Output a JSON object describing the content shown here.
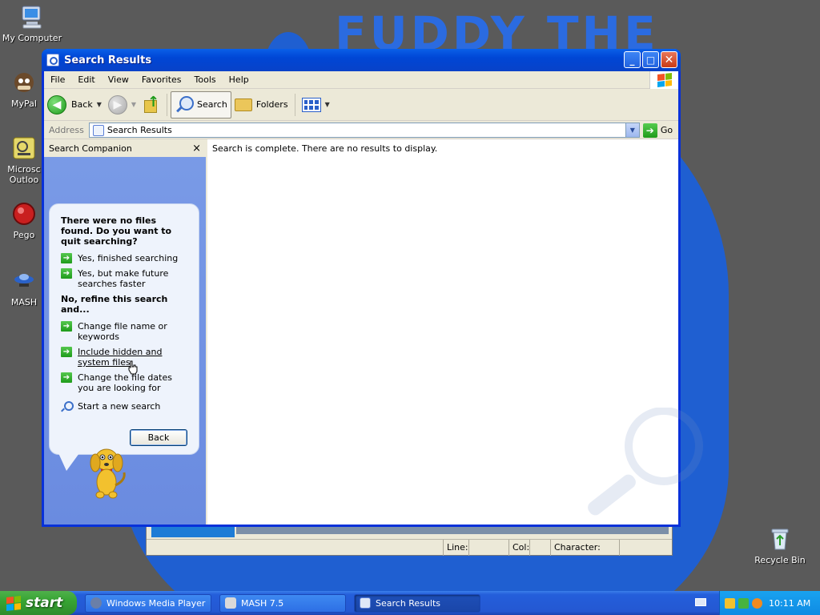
{
  "desktop": {
    "wallpaper_text": "FUDDY THE",
    "icons": [
      {
        "label": "My Computer",
        "icon": "computer-icon"
      },
      {
        "label": "MyPal",
        "icon": "mypal-icon"
      },
      {
        "label": "Microsc Outloo",
        "icon": "outlook-icon"
      },
      {
        "label": "Pego",
        "icon": "pego-icon"
      },
      {
        "label": "MASH",
        "icon": "mash-icon"
      },
      {
        "label": "Recycle Bin",
        "icon": "recycle-bin-icon"
      }
    ]
  },
  "background_window": {
    "status": {
      "line": "Line:",
      "col": "Col:",
      "character": "Character:"
    }
  },
  "window": {
    "title": "Search Results",
    "menu": [
      "File",
      "Edit",
      "View",
      "Favorites",
      "Tools",
      "Help"
    ],
    "toolbar": {
      "back": "Back",
      "search": "Search",
      "folders": "Folders"
    },
    "address": {
      "label": "Address",
      "value": "Search Results",
      "go": "Go"
    },
    "search_companion": {
      "title": "Search Companion",
      "close": "×",
      "heading": "There were no files found. Do you want to quit searching?",
      "options_quit": [
        "Yes, finished searching",
        "Yes, but make future searches faster"
      ],
      "refine_heading": "No, refine this search and...",
      "options_refine": [
        "Change file name or keywords",
        "Include hidden and system files",
        "Change the file dates you are looking for"
      ],
      "new_search": "Start a new search",
      "back_button": "Back"
    },
    "results": {
      "message": "Search is complete. There are no results to display."
    }
  },
  "taskbar": {
    "start": "start",
    "tasks": [
      {
        "label": "Windows Media Player",
        "active": false
      },
      {
        "label": "MASH 7.5",
        "active": false
      },
      {
        "label": "Search Results",
        "active": true
      }
    ],
    "clock": "10:11 AM"
  },
  "colors": {
    "xp_blue": "#0046d5",
    "companion_blue": "#7a9be7",
    "start_green": "#37a533",
    "tray_blue": "#0f8be3"
  }
}
